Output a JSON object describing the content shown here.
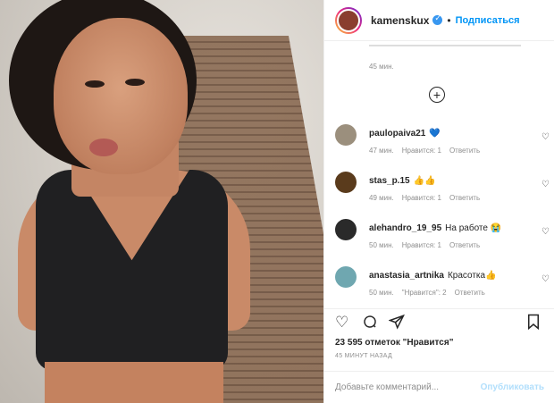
{
  "post": {
    "username": "kamenskux",
    "follow_label": "Подписаться",
    "caption_time": "45 мин.",
    "likes": "23 595 отметок \"Нравится\"",
    "posted_ago": "45 МИНУТ НАЗАД",
    "comment_placeholder": "Добавьте комментарий...",
    "publish_label": "Опубликовать"
  },
  "comments": [
    {
      "user": "paulopaiva21",
      "text": "💙",
      "time": "47 мин.",
      "likes": "Нравится: 1",
      "reply": "Ответить",
      "avatar_color": "#9b8f7d"
    },
    {
      "user": "stas_p.15",
      "text": "👍👍",
      "time": "49 мин.",
      "likes": "Нравится: 1",
      "reply": "Ответить",
      "avatar_color": "#5a3b1c"
    },
    {
      "user": "alehandro_19_95",
      "text": "На работе 😭",
      "time": "50 мин.",
      "likes": "Нравится: 1",
      "reply": "Ответить",
      "avatar_color": "#2a2a2a"
    },
    {
      "user": "anastasia_artnika",
      "text": "Красотка👍",
      "time": "50 мин.",
      "likes": "\"Нравится\": 2",
      "reply": "Ответить",
      "avatar_color": "#6fa7b0"
    }
  ],
  "icons": {
    "verified": "verified-badge-icon",
    "load_more": "plus-circle-icon",
    "like": "heart-icon",
    "comment": "comment-icon",
    "share": "share-icon",
    "save": "bookmark-icon"
  },
  "colors": {
    "accent": "#0095f6",
    "verified": "#3897f0",
    "muted": "#8e8e8e"
  }
}
